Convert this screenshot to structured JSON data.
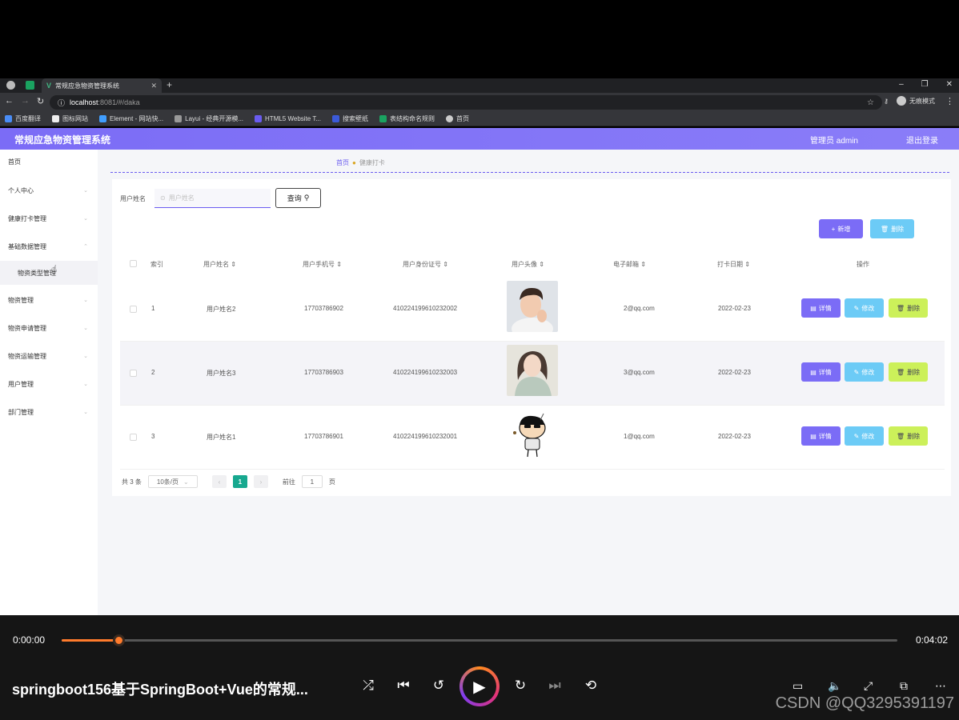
{
  "browser": {
    "tab_title": "常规应急物资管理系统",
    "tab_icon_letter": "V",
    "new_tab": "+",
    "url_host": "localhost",
    "url_rest": ":8081/#/daka",
    "profile_label": "无痕模式",
    "bookmarks": [
      "百度翻译",
      "图标网站",
      "Element - 网站快...",
      "Layui - 经典开源模...",
      "HTML5 Website T...",
      "搜索壁纸",
      "表结构命名规则",
      "首页"
    ]
  },
  "header": {
    "title": "常规应急物资管理系统",
    "user": "管理员 admin",
    "logout": "退出登录"
  },
  "sidebar": {
    "items": [
      {
        "label": "首页",
        "has_arrow": false
      },
      {
        "label": "个人中心",
        "has_arrow": true
      },
      {
        "label": "健康打卡管理",
        "has_arrow": true
      },
      {
        "label": "基础数据管理",
        "has_arrow": true
      },
      {
        "label": "物资类型管理",
        "has_arrow": false
      },
      {
        "label": "物资管理",
        "has_arrow": true
      },
      {
        "label": "物资申请管理",
        "has_arrow": true
      },
      {
        "label": "物资运输管理",
        "has_arrow": true
      },
      {
        "label": "用户管理",
        "has_arrow": true
      },
      {
        "label": "部门管理",
        "has_arrow": true
      }
    ]
  },
  "breadcrumb": {
    "home": "首页",
    "current": "健康打卡"
  },
  "search": {
    "label": "用户姓名",
    "placeholder": "用户姓名",
    "button": "查询"
  },
  "actions": {
    "add": "新增",
    "delete": "删除"
  },
  "table": {
    "headers": [
      "索引",
      "用户姓名",
      "用户手机号",
      "用户身份证号",
      "用户头像",
      "电子邮箱",
      "打卡日期",
      "操作"
    ],
    "rows": [
      {
        "index": "1",
        "name": "用户姓名2",
        "phone": "17703786902",
        "id_card": "410224199610232002",
        "email": "2@qq.com",
        "date": "2022-02-23",
        "avatar": "man-photo"
      },
      {
        "index": "2",
        "name": "用户姓名3",
        "phone": "17703786903",
        "id_card": "410224199610232003",
        "email": "3@qq.com",
        "date": "2022-02-23",
        "avatar": "woman-photo"
      },
      {
        "index": "3",
        "name": "用户姓名1",
        "phone": "17703786901",
        "id_card": "410224199610232001",
        "email": "1@qq.com",
        "date": "2022-02-23",
        "avatar": "cartoon-boy"
      }
    ],
    "op_labels": {
      "detail": "详情",
      "edit": "修改",
      "remove": "删除"
    }
  },
  "pagination": {
    "total": "共 3 条",
    "page_size": "10条/页",
    "current": "1",
    "goto_prefix": "前往",
    "goto_value": "1",
    "goto_suffix": "页"
  },
  "player": {
    "current_time": "0:00:00",
    "duration": "0:04:02",
    "progress_fraction": 0.068,
    "title": "springboot156基于SpringBoot+Vue的常规...",
    "watermark": "CSDN @QQ3295391197"
  },
  "colors": {
    "accent": "#7b6cf6",
    "info": "#6ccbf6",
    "warn": "#ccf05a",
    "pager": "#17a88f",
    "progress": "#ff7b2c"
  }
}
